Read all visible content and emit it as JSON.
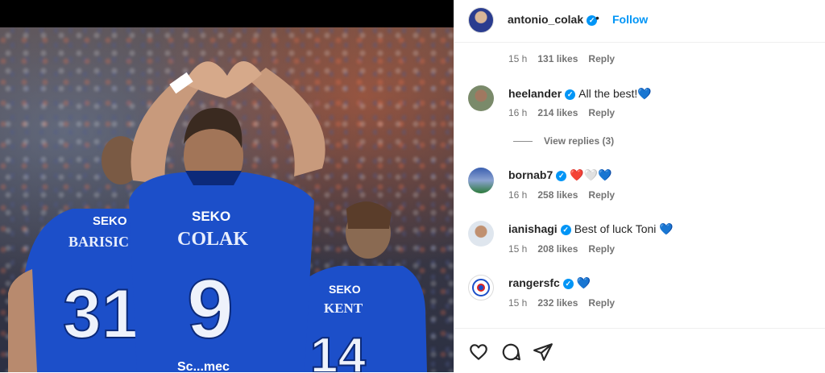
{
  "post": {
    "author": "antonio_colak",
    "follow_label": "Follow",
    "separator": "•"
  },
  "photo": {
    "jerseys": [
      {
        "sponsor": "SEKO",
        "name": "BARISIC",
        "number": "31"
      },
      {
        "sponsor": "SEKO",
        "name": "COLAK",
        "number": "9"
      },
      {
        "sponsor": "SEKO",
        "name": "KENT",
        "number": "14"
      }
    ],
    "sponsor_bottom": "Sc...mec"
  },
  "comments": [
    {
      "username": "",
      "text": "",
      "time": "15 h",
      "likes": "131 likes",
      "reply": "Reply",
      "verified": false
    },
    {
      "username": "heelander",
      "text": "All the best!💙",
      "time": "16 h",
      "likes": "214 likes",
      "reply": "Reply",
      "verified": true
    },
    {
      "username": "bornab7",
      "text": "❤️🤍💙",
      "time": "16 h",
      "likes": "258 likes",
      "reply": "Reply",
      "verified": true
    },
    {
      "username": "ianishagi",
      "text": "Best of luck Toni 💙",
      "time": "15 h",
      "likes": "208 likes",
      "reply": "Reply",
      "verified": true
    },
    {
      "username": "rangersfc",
      "text": "💙",
      "time": "15 h",
      "likes": "232 likes",
      "reply": "Reply",
      "verified": true
    }
  ],
  "view_replies": "View replies (3)",
  "icons": [
    "heart-icon",
    "comment-icon",
    "share-icon",
    "verified-icon"
  ],
  "colors": {
    "accent": "#0095f6",
    "jersey_blue": "#1c4fc9",
    "text": "#262626",
    "muted": "#737373"
  }
}
